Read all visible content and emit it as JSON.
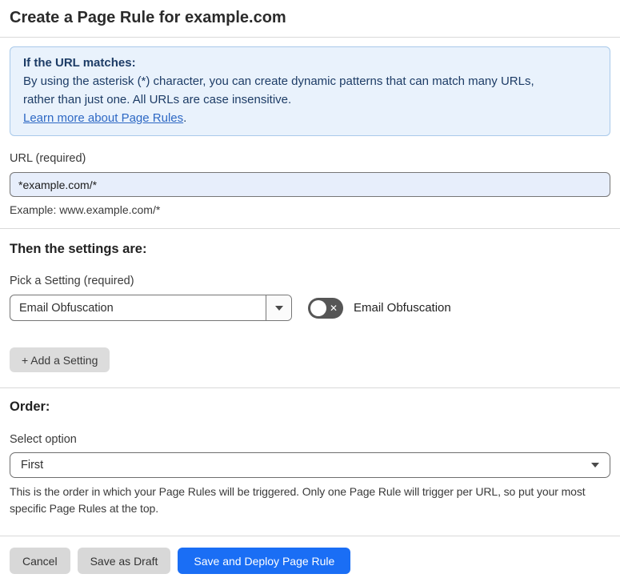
{
  "header": {
    "title": "Create a Page Rule for example.com"
  },
  "info_box": {
    "heading": "If the URL matches:",
    "body_lines": [
      "By using the asterisk (*) character, you can create dynamic patterns that can match many URLs,",
      "rather than just one. All URLs are case insensitive."
    ],
    "link_label": "Learn more about Page Rules",
    "link_suffix": "."
  },
  "url_field": {
    "label": "URL (required)",
    "value": "*example.com/*",
    "example": "Example: www.example.com/*"
  },
  "settings_section": {
    "heading": "Then the settings are:",
    "picker_label": "Pick a Setting (required)",
    "picker_value": "Email Obfuscation",
    "toggle_state": "off",
    "toggle_off_glyph": "✕",
    "toggle_label": "Email Obfuscation",
    "add_setting_button": "+ Add a Setting"
  },
  "order_section": {
    "heading": "Order:",
    "select_label": "Select option",
    "select_value": "First",
    "help_text": "This is the order in which your Page Rules will be triggered. Only one Page Rule will trigger per URL, so put your most specific Page Rules at the top."
  },
  "footer": {
    "cancel_label": "Cancel",
    "save_draft_label": "Save as Draft",
    "save_deploy_label": "Save and Deploy Page Rule"
  },
  "colors": {
    "primary_blue": "#1a6ef5",
    "info_box_bg": "#e9f2fc",
    "info_box_border": "#a9c9ea",
    "info_text": "#1d3c66",
    "link_blue": "#2d68c4",
    "url_input_bg": "#e7eefb",
    "toggle_off_bg": "#565656",
    "secondary_button_bg": "#d8d8d8"
  }
}
